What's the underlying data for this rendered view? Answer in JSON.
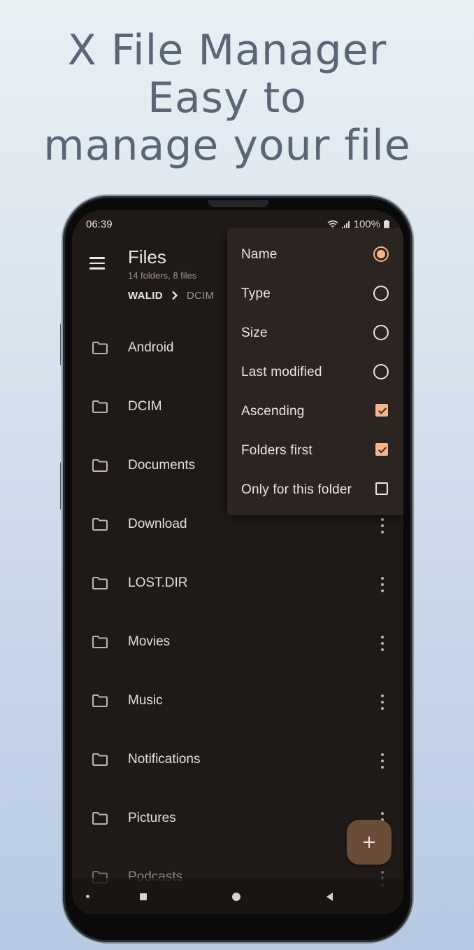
{
  "promo": {
    "line1": "X File Manager",
    "line2": "Easy to",
    "line3": "manage your file"
  },
  "status_bar": {
    "time": "06:39",
    "battery": "100%",
    "icons": [
      "wifi-icon",
      "signal-icon",
      "battery-icon"
    ]
  },
  "app_bar": {
    "menu_icon": "hamburger-menu-icon",
    "title": "Files",
    "subtitle": "14 folders, 8 files"
  },
  "breadcrumb": {
    "items": [
      "WALID",
      "DCIM"
    ],
    "separator_icon": "chevron-right-icon"
  },
  "files": [
    {
      "name": "Android",
      "icon": "folder-icon"
    },
    {
      "name": "DCIM",
      "icon": "folder-icon"
    },
    {
      "name": "Documents",
      "icon": "folder-icon"
    },
    {
      "name": "Download",
      "icon": "folder-icon"
    },
    {
      "name": "LOST.DIR",
      "icon": "folder-icon"
    },
    {
      "name": "Movies",
      "icon": "folder-icon"
    },
    {
      "name": "Music",
      "icon": "folder-icon"
    },
    {
      "name": "Notifications",
      "icon": "folder-icon"
    },
    {
      "name": "Pictures",
      "icon": "folder-icon"
    },
    {
      "name": "Podcasts",
      "icon": "folder-icon"
    }
  ],
  "sort_menu": {
    "options": [
      {
        "label": "Name",
        "type": "radio",
        "checked": true
      },
      {
        "label": "Type",
        "type": "radio",
        "checked": false
      },
      {
        "label": "Size",
        "type": "radio",
        "checked": false
      },
      {
        "label": "Last modified",
        "type": "radio",
        "checked": false
      },
      {
        "label": "Ascending",
        "type": "checkbox",
        "checked": true
      },
      {
        "label": "Folders first",
        "type": "checkbox",
        "checked": true
      },
      {
        "label": "Only for this folder",
        "type": "checkbox",
        "checked": false
      }
    ]
  },
  "fab": {
    "label": "+",
    "icon": "plus-icon"
  },
  "nav_bar": {
    "buttons": [
      "recents-button",
      "home-button",
      "back-button"
    ]
  },
  "colors": {
    "accent": "#f6b58c",
    "background": "#1f1a17",
    "menu_surface": "#2c2420",
    "fab": "#6b4c37",
    "promo_text": "#5a6676"
  }
}
